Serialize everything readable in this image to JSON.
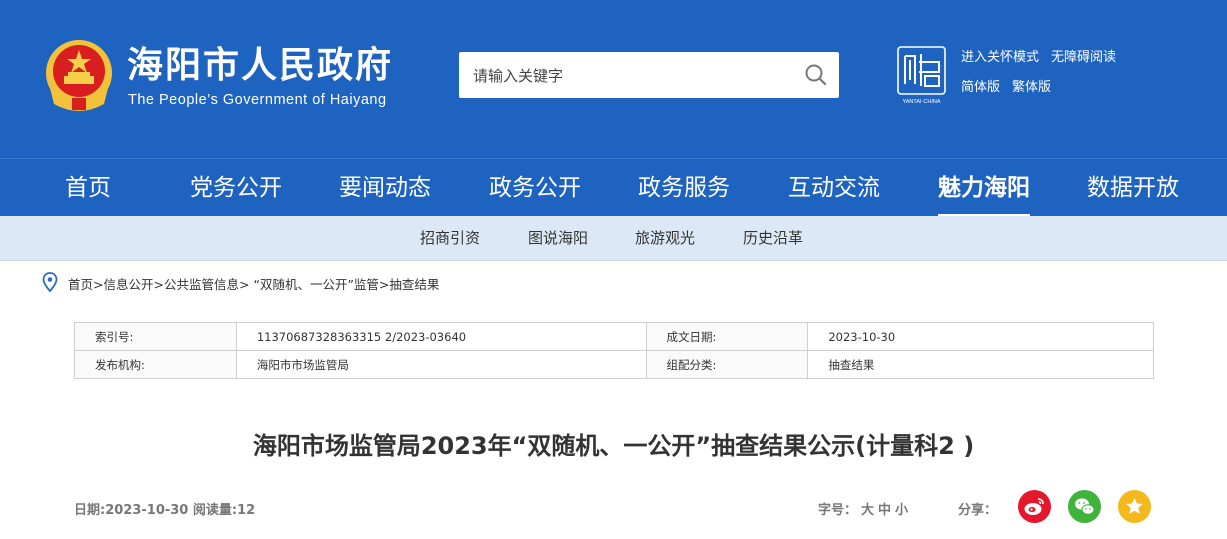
{
  "header": {
    "site_title": "海阳市人民政府",
    "site_subtitle": "The People’s Government of Haiyang",
    "search": {
      "placeholder": "请输入关键字"
    },
    "logo_text": "YANTAI·CHINA",
    "quick_links": [
      "进入关怀模式",
      "无障碍阅读",
      "简体版",
      "繁体版"
    ]
  },
  "nav": {
    "items": [
      "首页",
      "党务公开",
      "要闻动态",
      "政务公开",
      "政务服务",
      "互动交流",
      "魅力海阳",
      "数据开放"
    ],
    "active": "魅力海阳"
  },
  "subnav": {
    "items": [
      "招商引资",
      "图说海阳",
      "旅游观光",
      "历史沿革"
    ]
  },
  "breadcrumb": [
    "首页",
    "信息公开",
    "公共监管信息",
    "“双随机、一公开”监管",
    "抽查结果"
  ],
  "meta": {
    "rows": [
      {
        "label1": "索引号:",
        "value1": "11370687328363315 2/2023-03640",
        "label2": "成文日期:",
        "value2": "2023-10-30"
      },
      {
        "label1": "发布机构:",
        "value1": "海阳市市场监管局",
        "label2": "组配分类:",
        "value2": "抽查结果"
      }
    ]
  },
  "article": {
    "title": "海阳市场监管局2023年“双随机、一公开”抽查结果公示(计量科2 )",
    "info": "日期:2023-10-30 阅读量:12",
    "fontsize_label": "字号：",
    "fontsize_options": [
      "大",
      "中",
      "小"
    ],
    "share_label": "分享："
  },
  "colors": {
    "primary": "#1f63c1",
    "subnav_bg": "#dde8f6",
    "weibo": "#e6162d",
    "wechat": "#3fb33a",
    "favorite": "#f5b81c"
  }
}
